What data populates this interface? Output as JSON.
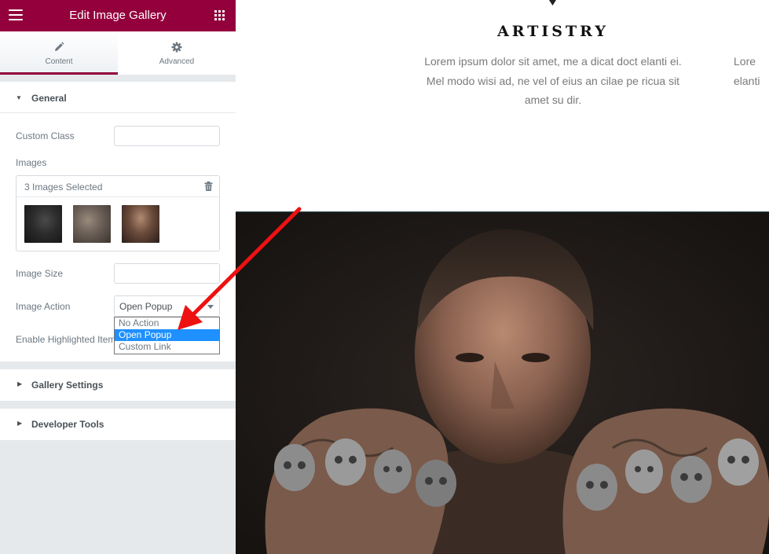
{
  "panel": {
    "title": "Edit Image Gallery",
    "tabs": [
      {
        "label": "Content",
        "icon": "pencil-icon"
      },
      {
        "label": "Advanced",
        "icon": "gear-icon"
      }
    ],
    "accent_color": "#93003c"
  },
  "general": {
    "section_label": "General",
    "custom_class_label": "Custom Class",
    "custom_class_value": "",
    "images_label": "Images",
    "images_count": "3 Images Selected",
    "image_size_label": "Image Size",
    "image_size_value": "",
    "image_action_label": "Image Action",
    "image_action_value": "Open Popup",
    "image_action_options": [
      "No Action",
      "Open Popup",
      "Custom Link"
    ],
    "highlighted_label": "Enable Highlighted Item"
  },
  "sections": {
    "gallery_settings": "Gallery Settings",
    "developer_tools": "Developer Tools"
  },
  "preview": {
    "heading": "ARTISTRY",
    "paragraph": "Lorem ipsum dolor sit amet, me a dicat doct elanti ei. Mel modo wisi ad, ne vel of eius an cilae pe ricua sit amet su dir.",
    "paragraph_clipped_line1": "Lore",
    "paragraph_clipped_line2": "elanti"
  },
  "annotation": {
    "arrow_color": "#ee1111"
  }
}
